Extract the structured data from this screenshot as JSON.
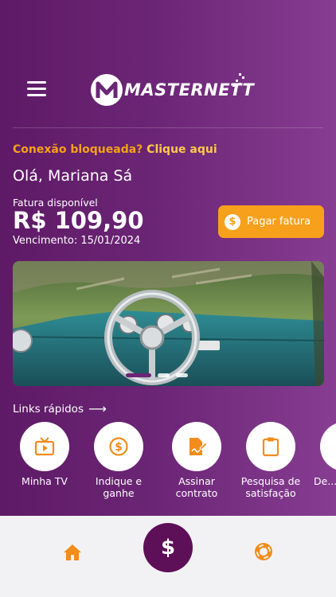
{
  "header": {
    "menu_icon": "hamburger-menu-icon",
    "logo_text": "MASTERNETT"
  },
  "alert": {
    "question": "Conexão bloqueada?",
    "link": "Clique aqui"
  },
  "greeting": "Olá, Mariana Sá",
  "invoice": {
    "label": "Fatura disponível",
    "amount": "R$ 109,90",
    "due": "Vencimento: 15/01/2024",
    "pay_button_label": "Pagar fatura",
    "pay_button_icon": "dollar-coin-icon"
  },
  "banner": {
    "image_icon": "car-steering-wheel-photo",
    "slides": 3,
    "active_slide": 1
  },
  "quick_links": {
    "title": "Links rápidos",
    "items": [
      {
        "label": "Minha TV",
        "icon": "tv-icon"
      },
      {
        "label": "Indique e ganhe",
        "icon": "dollar-circle-icon"
      },
      {
        "label": "Assinar contrato",
        "icon": "sign-document-icon"
      },
      {
        "label": "Pesquisa de satisfação",
        "icon": "clipboard-icon"
      },
      {
        "label": "De... a...",
        "icon": "partial-icon"
      }
    ]
  },
  "bottom_nav": {
    "home_icon": "home-icon",
    "center_icon": "dollar-icon",
    "center_label": "$",
    "support_icon": "lifebuoy-icon"
  },
  "colors": {
    "brand_purple": "#6b2575",
    "accent_orange": "#f7a01b",
    "link_yellow": "#ffc94a",
    "nav_dark": "#5d0f57"
  }
}
